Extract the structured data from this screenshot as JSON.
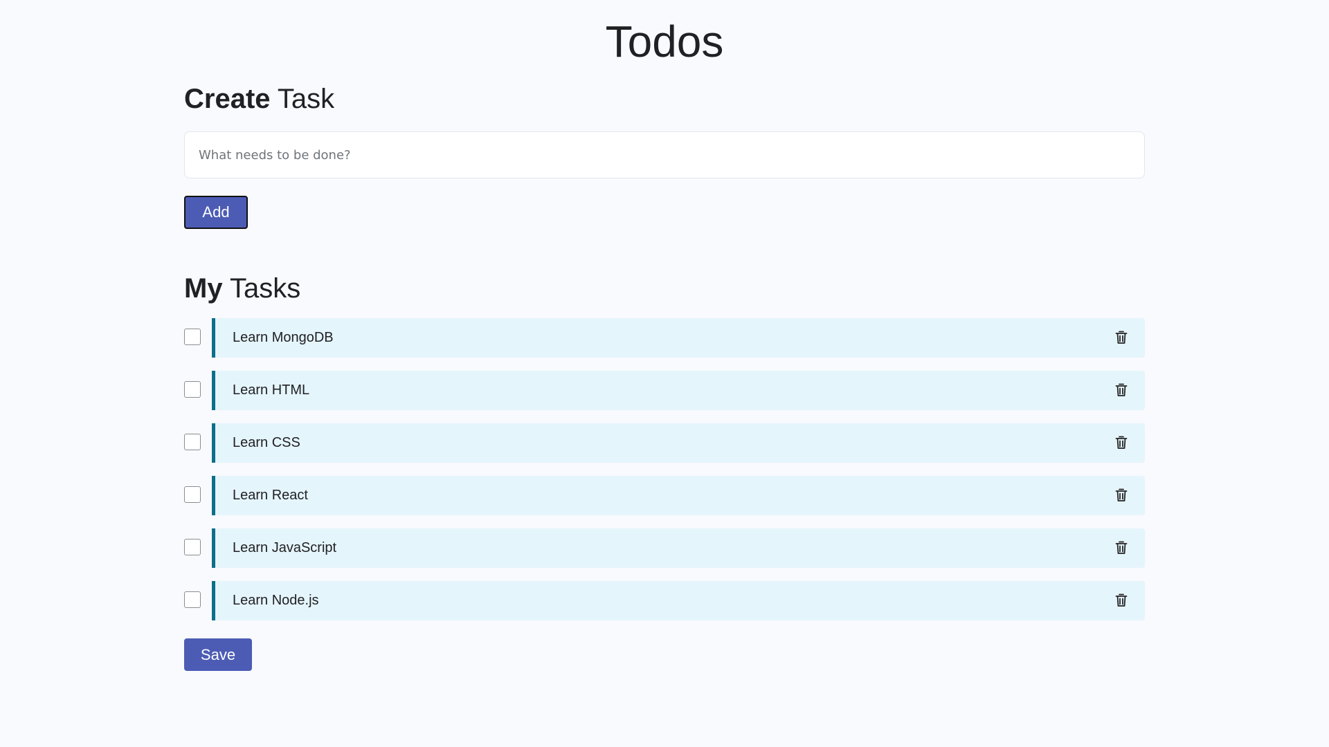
{
  "page": {
    "title": "Todos"
  },
  "create": {
    "heading_bold": "Create",
    "heading_rest": "Task",
    "input_placeholder": "What needs to be done?",
    "input_value": "",
    "add_label": "Add"
  },
  "tasks": {
    "heading_bold": "My",
    "heading_rest": "Tasks",
    "items": [
      {
        "label": "Learn MongoDB",
        "checked": false
      },
      {
        "label": "Learn HTML",
        "checked": false
      },
      {
        "label": "Learn CSS",
        "checked": false
      },
      {
        "label": "Learn React",
        "checked": false
      },
      {
        "label": "Learn JavaScript",
        "checked": false
      },
      {
        "label": "Learn Node.js",
        "checked": false
      }
    ],
    "save_label": "Save"
  },
  "icons": {
    "delete": "trash-icon"
  },
  "colors": {
    "primary_button": "#4c5cb5",
    "task_background": "#e5f5fc",
    "task_accent": "#0d6f89",
    "page_background": "#f8fafd"
  }
}
